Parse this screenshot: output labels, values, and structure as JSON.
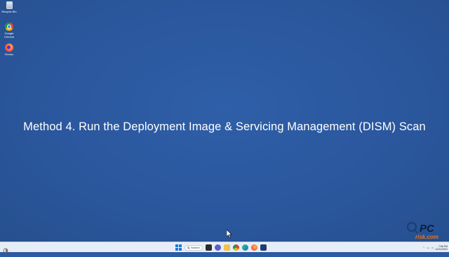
{
  "desktop_icons": [
    {
      "label": "Recycle Bin",
      "icon": "recycle-bin-icon"
    },
    {
      "label": "Google Chrome",
      "icon": "chrome-icon"
    },
    {
      "label": "Firefox",
      "icon": "firefox-icon"
    }
  ],
  "headline": "Method 4. Run the Deployment Image & Servicing Management (DISM) Scan",
  "taskbar": {
    "search_label": "Search",
    "time": "7:56 PM",
    "date": "12/21/2022",
    "apps": [
      "file-explorer-icon",
      "chat-icon",
      "folder-icon",
      "chrome-icon",
      "edge-icon",
      "firefox-icon",
      "app-icon"
    ]
  },
  "watermark": {
    "line1": "PC",
    "line2": "risk.com"
  },
  "colors": {
    "desktop": "#2d5aa0",
    "taskbar": "#e6edf6",
    "headline": "#ffffff"
  }
}
